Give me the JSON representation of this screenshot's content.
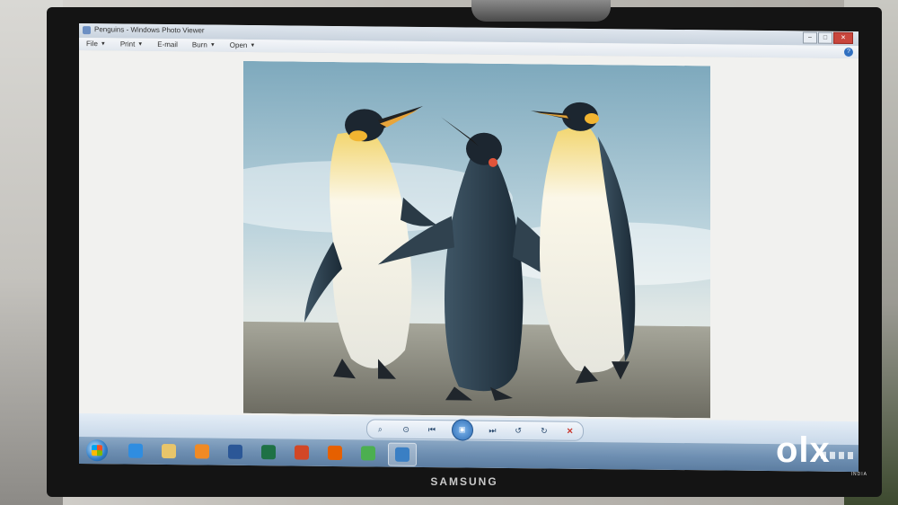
{
  "window": {
    "title": "Penguins - Windows Photo Viewer"
  },
  "menu": {
    "items": [
      {
        "label": "File",
        "has_dropdown": true
      },
      {
        "label": "Print",
        "has_dropdown": true
      },
      {
        "label": "E-mail",
        "has_dropdown": false
      },
      {
        "label": "Burn",
        "has_dropdown": true
      },
      {
        "label": "Open",
        "has_dropdown": true
      }
    ],
    "help_icon": "help-icon"
  },
  "controls": [
    {
      "name": "zoom-icon",
      "glyph": "⌕"
    },
    {
      "name": "actual-size-icon",
      "glyph": "⊙"
    },
    {
      "name": "previous-icon",
      "glyph": "⏮"
    },
    {
      "name": "slideshow-play-icon",
      "glyph": "▣"
    },
    {
      "name": "next-icon",
      "glyph": "⏭"
    },
    {
      "name": "rotate-left-icon",
      "glyph": "↺"
    },
    {
      "name": "rotate-right-icon",
      "glyph": "↻"
    },
    {
      "name": "delete-icon",
      "glyph": "✕"
    }
  ],
  "taskbar": {
    "apps": [
      {
        "name": "internet-explorer-icon",
        "color": "#2f8de0"
      },
      {
        "name": "windows-explorer-icon",
        "color": "#e8c56a"
      },
      {
        "name": "media-player-icon",
        "color": "#f08a24"
      },
      {
        "name": "word-icon",
        "color": "#2b5797"
      },
      {
        "name": "excel-icon",
        "color": "#1e7145"
      },
      {
        "name": "powerpoint-icon",
        "color": "#d24726"
      },
      {
        "name": "firefox-icon",
        "color": "#e66000"
      },
      {
        "name": "chrome-icon",
        "color": "#4caf50"
      },
      {
        "name": "photo-viewer-icon",
        "color": "#3a7fc4"
      }
    ],
    "active_app": "photo-viewer-icon"
  },
  "monitor": {
    "brand": "SAMSUNG"
  },
  "watermark": {
    "text": "olx",
    "sub": "INDIA"
  }
}
